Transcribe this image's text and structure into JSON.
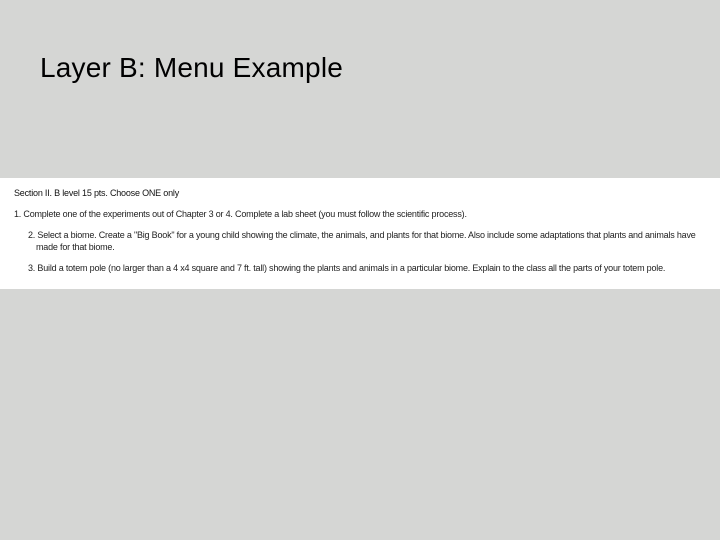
{
  "title": "Layer B: Menu Example",
  "section_heading": "Section II. B level 15 pts. Choose ONE only",
  "items": [
    "1. Complete one of the experiments out of  Chapter 3 or 4.  Complete a lab sheet (you must follow the scientific process).",
    "2. Select a biome. Create a \"Big Book\" for a young child showing the climate, the animals, and plants for that biome.  Also include some adaptations that plants and animals have made for that biome.",
    "3. Build a totem pole (no larger than a 4 x4 square and 7 ft. tall) showing the plants and animals in a particular biome.  Explain to the class all the parts of your totem pole."
  ]
}
